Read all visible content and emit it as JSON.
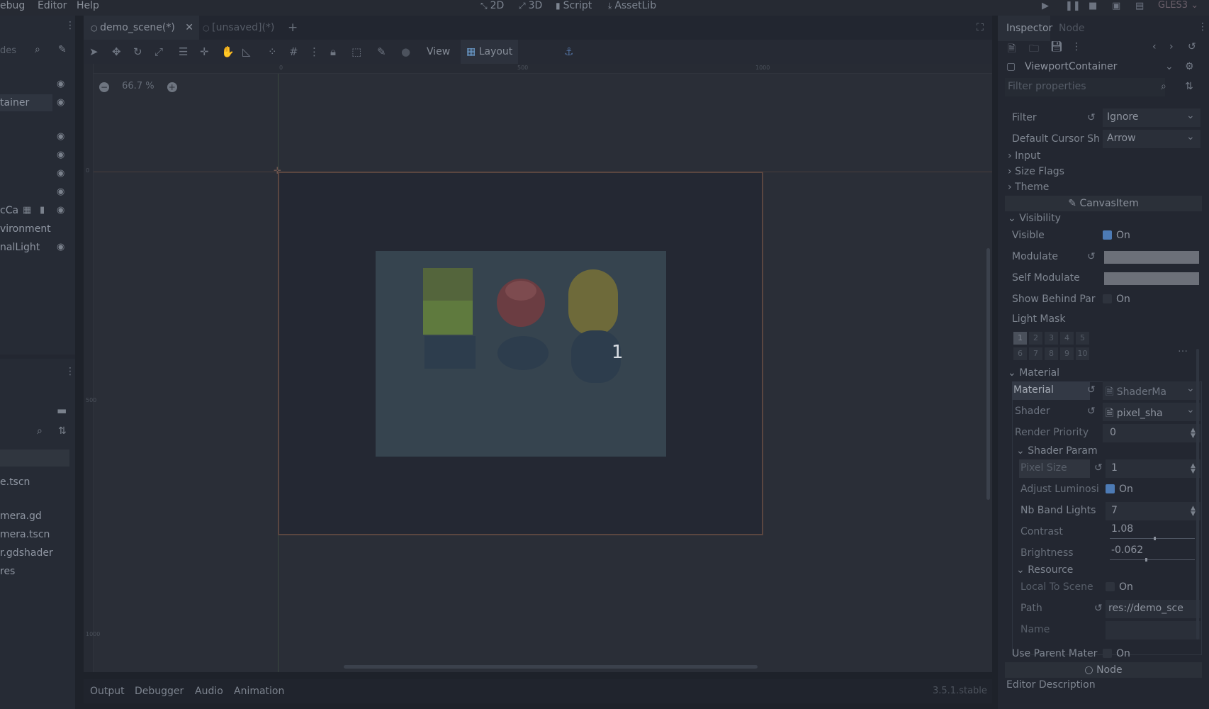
{
  "menubar": {
    "menus": [
      "ebug",
      "Editor",
      "Help"
    ],
    "workspaces": [
      {
        "label": "2D",
        "icon": "2d-icon"
      },
      {
        "label": "3D",
        "icon": "3d-icon"
      },
      {
        "label": "Script",
        "icon": "script-icon"
      },
      {
        "label": "AssetLib",
        "icon": "assetlib-icon"
      }
    ],
    "renderer": "GLES3"
  },
  "scene_dock": {
    "search_text": "des",
    "rows": [
      {
        "label": ""
      },
      {
        "label": "tainer"
      },
      {
        "label": ""
      },
      {
        "label": ""
      },
      {
        "label": ""
      },
      {
        "label": ""
      },
      {
        "label": "cCa"
      },
      {
        "label": "vironment"
      },
      {
        "label": "nalLight"
      }
    ]
  },
  "filesystem_dock": {
    "files": [
      "e.tscn",
      "",
      "mera.gd",
      "mera.tscn",
      "r.gdshader",
      "res"
    ]
  },
  "scene_tabs": [
    {
      "label": "demo_scene(*)"
    },
    {
      "label": "[unsaved](*)"
    }
  ],
  "toolbar": {
    "view_label": "View",
    "layout_label": "Layout"
  },
  "viewport": {
    "zoom": "66.7 %",
    "ruler_top": [
      "0",
      "500",
      "1000"
    ],
    "ruler_left": [
      "0",
      "500",
      "1000"
    ],
    "overlay_number": "1"
  },
  "bottom_panel": {
    "tabs": [
      "Output",
      "Debugger",
      "Audio",
      "Animation"
    ],
    "version": "3.5.1.stable"
  },
  "inspector": {
    "tabs": [
      "Inspector",
      "Node"
    ],
    "node_type": "ViewportContainer",
    "filter_placeholder": "Filter properties",
    "props": {
      "filter_label": "Filter",
      "filter_value": "Ignore",
      "cursor_label": "Default Cursor Sh",
      "cursor_value": "Arrow",
      "input": "Input",
      "size_flags": "Size Flags",
      "theme": "Theme",
      "canvas_item": "CanvasItem",
      "visibility": "Visibility",
      "visible_label": "Visible",
      "visible_value": "On",
      "modulate_label": "Modulate",
      "self_modulate_label": "Self Modulate",
      "show_behind_label": "Show Behind Par",
      "show_behind_value": "On",
      "light_mask_label": "Light Mask",
      "light_mask_bits": [
        "1",
        "2",
        "3",
        "4",
        "5",
        "6",
        "7",
        "8",
        "9",
        "10"
      ],
      "material_section": "Material",
      "material_label": "Material",
      "material_value": "ShaderMa",
      "shader_label": "Shader",
      "shader_value": "pixel_sha",
      "render_priority_label": "Render Priority",
      "render_priority_value": "0",
      "shader_param": "Shader Param",
      "pixel_size_label": "Pixel Size",
      "pixel_size_value": "1",
      "adjust_lum_label": "Adjust Luminosi",
      "adjust_lum_value": "On",
      "nb_band_label": "Nb Band Lights",
      "nb_band_value": "7",
      "contrast_label": "Contrast",
      "contrast_value": "1.08",
      "brightness_label": "Brightness",
      "brightness_value": "-0.062",
      "resource": "Resource",
      "local_scene_label": "Local To Scene",
      "local_scene_value": "On",
      "path_label": "Path",
      "path_value": "res://demo_sce",
      "name_label": "Name",
      "use_parent_label": "Use Parent Mater",
      "use_parent_value": "On",
      "node_section": "Node",
      "editor_desc_label": "Editor Description"
    }
  },
  "colors": {
    "accent": "#4d7bb5",
    "frame_border": "#5a4640",
    "viewport_bg": "#2a2e37"
  }
}
